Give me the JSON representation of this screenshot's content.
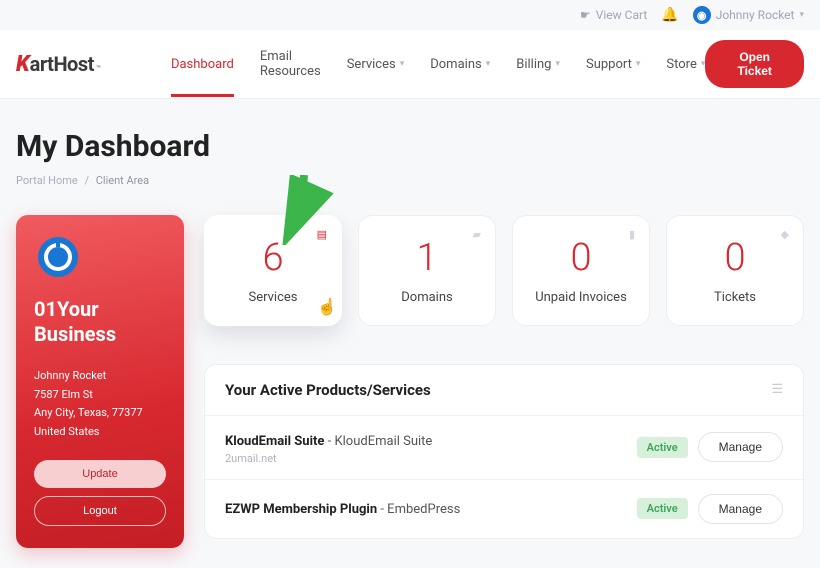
{
  "topbar": {
    "view_cart": "View Cart",
    "user_name": "Johnny Rocket"
  },
  "brand": {
    "mark": "K",
    "rest": "artHost",
    "tm": "™"
  },
  "nav": {
    "items": [
      {
        "label": "Dashboard",
        "active": true,
        "caret": false
      },
      {
        "label": "Email Resources",
        "active": false,
        "caret": false
      },
      {
        "label": "Services",
        "active": false,
        "caret": true
      },
      {
        "label": "Domains",
        "active": false,
        "caret": true
      },
      {
        "label": "Billing",
        "active": false,
        "caret": true
      },
      {
        "label": "Support",
        "active": false,
        "caret": true
      },
      {
        "label": "Store",
        "active": false,
        "caret": true
      }
    ],
    "open_ticket": "Open Ticket"
  },
  "page": {
    "title": "My Dashboard",
    "crumb_home": "Portal Home",
    "crumb_current": "Client Area"
  },
  "sidebar": {
    "business": "01Your Business",
    "name": "Johnny Rocket",
    "street": "7587 Elm St",
    "citystate": "Any City, Texas, 77377",
    "country": "United States",
    "update": "Update",
    "logout": "Logout"
  },
  "stats": [
    {
      "value": "6",
      "label": "Services"
    },
    {
      "value": "1",
      "label": "Domains"
    },
    {
      "value": "0",
      "label": "Unpaid Invoices"
    },
    {
      "value": "0",
      "label": "Tickets"
    }
  ],
  "products": {
    "heading": "Your Active Products/Services",
    "rows": [
      {
        "name": "KloudEmail Suite",
        "desc": " - KloudEmail Suite",
        "sub": "2umail.net",
        "status": "Active",
        "action": "Manage"
      },
      {
        "name": "EZWP Membership Plugin",
        "desc": " - EmbedPress",
        "sub": "",
        "status": "Active",
        "action": "Manage"
      }
    ]
  }
}
